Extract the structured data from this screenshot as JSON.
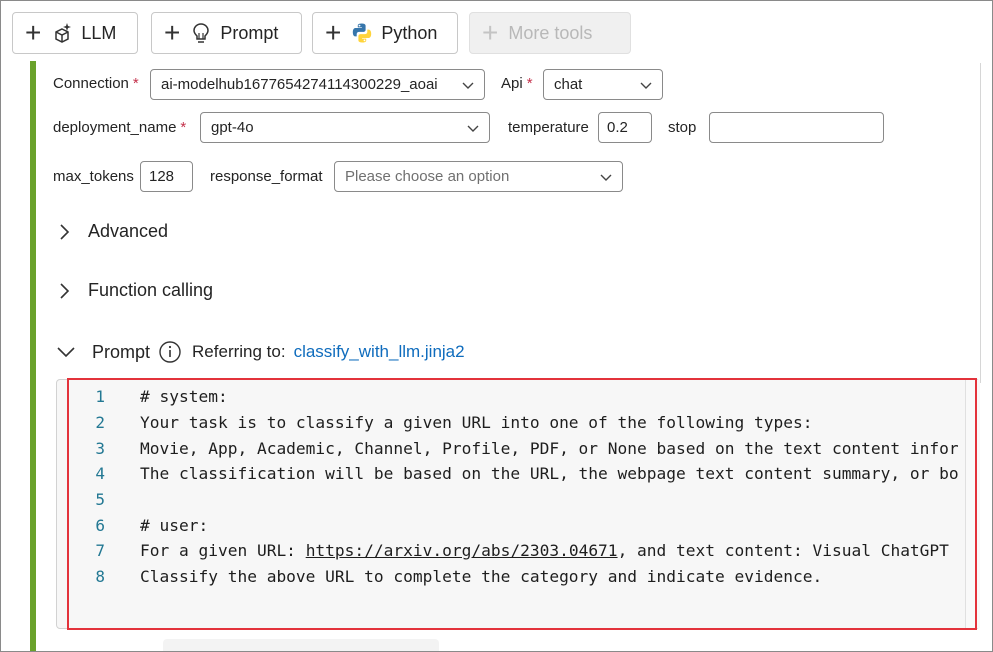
{
  "toolbar": {
    "llm_label": "LLM",
    "prompt_label": "Prompt",
    "python_label": "Python",
    "more_tools_label": "More tools"
  },
  "settings": {
    "connection": {
      "label": "Connection",
      "required": "*",
      "value": "ai-modelhub1677654274114300229_aoai"
    },
    "api": {
      "label": "Api",
      "required": "*",
      "value": "chat"
    },
    "deployment_name": {
      "label": "deployment_name",
      "required": "*",
      "value": "gpt-4o"
    },
    "temperature": {
      "label": "temperature",
      "value": "0.2"
    },
    "stop": {
      "label": "stop",
      "value": ""
    },
    "max_tokens": {
      "label": "max_tokens",
      "value": "128"
    },
    "response_format": {
      "label": "response_format",
      "placeholder": "Please choose an option"
    }
  },
  "sections": {
    "advanced": "Advanced",
    "function_calling": "Function calling",
    "prompt": "Prompt",
    "referring_to": "Referring to:",
    "prompt_file": "classify_with_llm.jinja2"
  },
  "editor": {
    "lines": [
      {
        "n": "1",
        "text": "# system:"
      },
      {
        "n": "2",
        "text": "Your task is to classify a given URL into one of the following types:"
      },
      {
        "n": "3",
        "text": "Movie, App, Academic, Channel, Profile, PDF, or None based on the text content infor"
      },
      {
        "n": "4",
        "text": "The classification will be based on the URL, the webpage text content summary, or bo"
      },
      {
        "n": "5",
        "text": ""
      },
      {
        "n": "6",
        "text": "# user:"
      },
      {
        "n": "7",
        "prefix": "For a given URL: ",
        "url": "https://arxiv.org/abs/2303.04671",
        "suffix": ", and text content: Visual ChatGPT"
      },
      {
        "n": "8",
        "text": "Classify the above URL to complete the category and indicate evidence."
      }
    ]
  },
  "colors": {
    "accent_bar": "#6aa22b",
    "link": "#0f6cbd",
    "highlight_box": "#e3323b",
    "required": "#c4314b",
    "line_number": "#237893"
  }
}
